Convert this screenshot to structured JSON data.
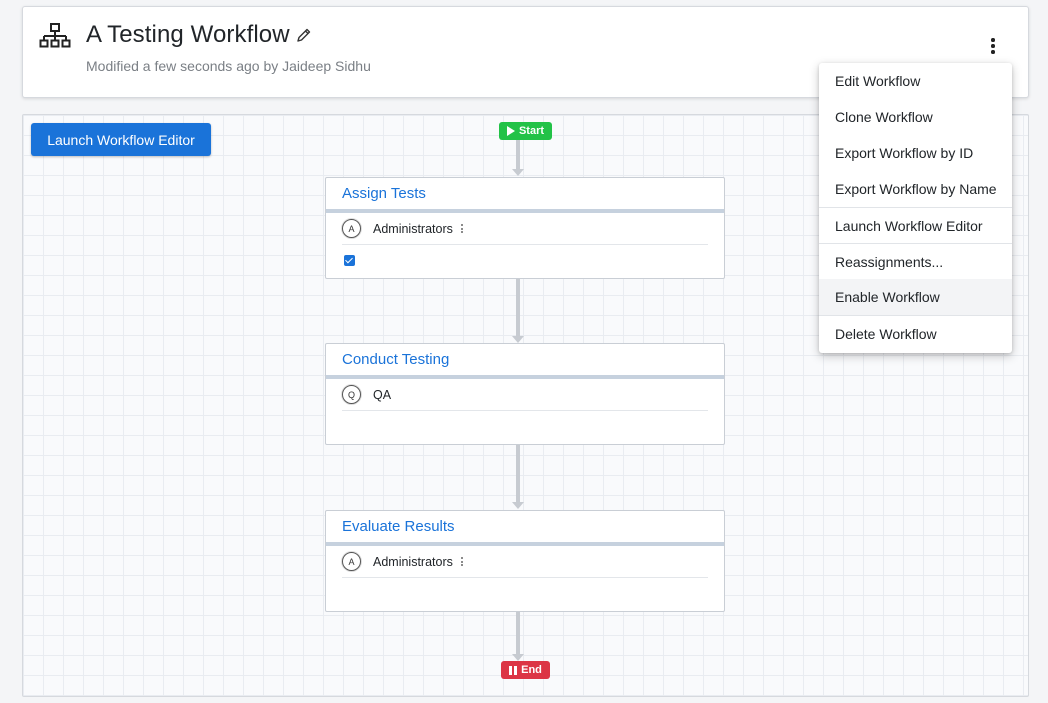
{
  "header": {
    "icon": "sitemap-icon",
    "title": "A Testing Workflow",
    "subtitle": "Modified a few seconds ago by Jaideep Sidhu"
  },
  "canvas": {
    "launch_button": "Launch Workflow Editor",
    "start_label": "Start",
    "end_label": "End",
    "nodes": [
      {
        "title": "Assign Tests",
        "assignee_initial": "A",
        "assignee": "Administrators",
        "checked": true
      },
      {
        "title": "Conduct Testing",
        "assignee_initial": "Q",
        "assignee": "QA"
      },
      {
        "title": "Evaluate Results",
        "assignee_initial": "A",
        "assignee": "Administrators"
      }
    ]
  },
  "menu": {
    "items": [
      "Edit Workflow",
      "Clone Workflow",
      "Export Workflow by ID",
      "Export Workflow by Name",
      "Launch Workflow Editor",
      "Reassignments...",
      "Enable Workflow",
      "Delete Workflow"
    ],
    "highlighted": "Enable Workflow"
  },
  "colors": {
    "accent": "#1a73d9",
    "start": "#22c247",
    "end": "#dc3545"
  }
}
